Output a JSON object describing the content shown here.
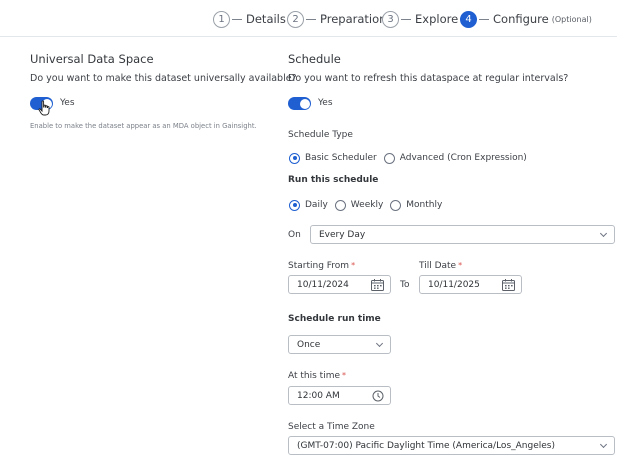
{
  "stepper": {
    "steps": [
      {
        "num": "1",
        "label": "Details",
        "optional": ""
      },
      {
        "num": "2",
        "label": "Preparation",
        "optional": ""
      },
      {
        "num": "3",
        "label": "Explore",
        "optional": ""
      },
      {
        "num": "4",
        "label": "Configure",
        "optional": "(Optional)"
      }
    ]
  },
  "left": {
    "title": "Universal Data Space",
    "question": "Do you want to make this dataset universally available?",
    "toggle_label": "Yes",
    "hint": "Enable to make the dataset appear as an MDA object in Gainsight."
  },
  "right": {
    "title": "Schedule",
    "question": "Do you want to refresh this dataspace at regular intervals?",
    "toggle_label": "Yes",
    "schedule_type_label": "Schedule Type",
    "schedule_types": [
      "Basic Scheduler",
      "Advanced (Cron Expression)"
    ],
    "run_label": "Run this schedule",
    "frequencies": [
      "Daily",
      "Weekly",
      "Monthly"
    ],
    "on_label": "On",
    "on_value": "Every Day",
    "starting_label": "Starting From",
    "starting_value": "10/11/2024",
    "to_label": "To",
    "till_label": "Till Date",
    "till_value": "10/11/2025",
    "run_time_label": "Schedule run time",
    "run_time_value": "Once",
    "at_time_label": "At this time",
    "at_time_value": "12:00 AM",
    "tz_label": "Select a Time Zone",
    "tz_value": "(GMT-07:00) Pacific Daylight Time (America/Los_Angeles)",
    "required_mark": "*"
  },
  "colors": {
    "accent": "#1f5fd1",
    "required": "#d9534f"
  }
}
